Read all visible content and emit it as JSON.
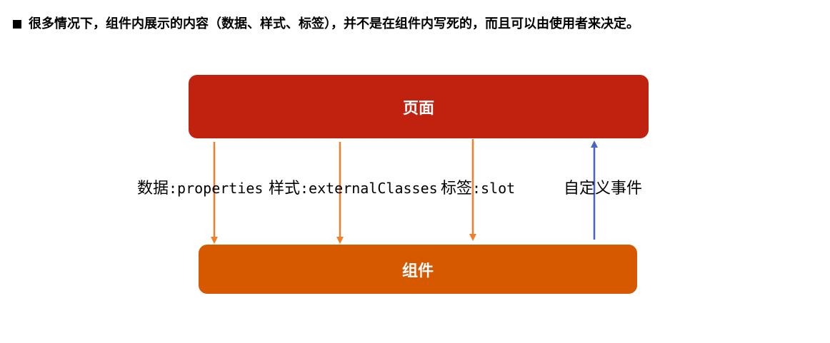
{
  "heading": {
    "text": "很多情况下，组件内展示的内容（数据、样式、标签），并不是在组件内写死的，而且可以由使用者来决定。"
  },
  "diagram": {
    "top_box": {
      "label": "页面",
      "color": "#c1220f"
    },
    "bottom_box": {
      "label": "组件",
      "color": "#d65900"
    },
    "labels": [
      {
        "prefix": "数据",
        "suffix": ":properties"
      },
      {
        "prefix": "样式",
        "suffix": ":externalClasses"
      },
      {
        "prefix": "标签",
        "suffix": ":slot"
      },
      {
        "prefix": "自定义事件",
        "suffix": ""
      }
    ],
    "arrow_colors": {
      "down": "#f07f2b",
      "up": "#4a64c5"
    }
  }
}
